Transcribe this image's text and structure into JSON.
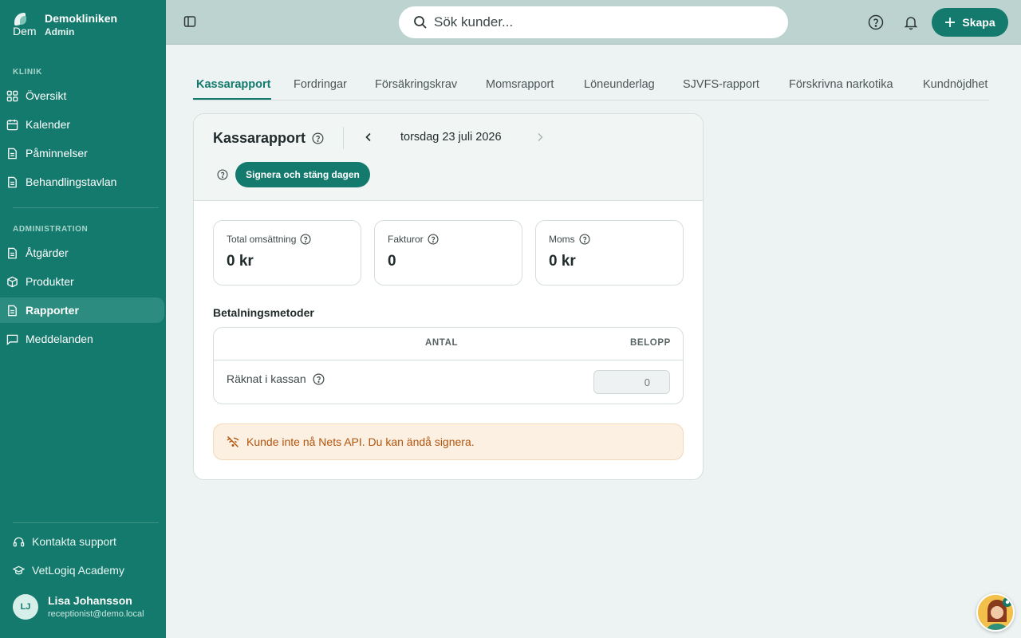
{
  "brand": {
    "name": "Demokliniken",
    "role": "Admin",
    "logo_text": "Dem"
  },
  "sidebar": {
    "section_clinic": "KLINIK",
    "section_admin": "ADMINISTRATION",
    "items": [
      {
        "label": "Översikt",
        "icon": "grid-icon"
      },
      {
        "label": "Kalender",
        "icon": "calendar-icon"
      },
      {
        "label": "Påminnelser",
        "icon": "document-icon"
      },
      {
        "label": "Behandlingstavlan",
        "icon": "document-icon"
      },
      {
        "label": "Åtgärder",
        "icon": "document-icon"
      },
      {
        "label": "Produkter",
        "icon": "box-icon"
      },
      {
        "label": "Rapporter",
        "icon": "document-icon",
        "active": true
      },
      {
        "label": "Meddelanden",
        "icon": "chat-icon"
      }
    ],
    "support": "Kontakta support",
    "academy": "VetLogiq Academy",
    "user": {
      "initials": "LJ",
      "name": "Lisa Johansson",
      "email": "receptionist@demo.local"
    }
  },
  "topbar": {
    "search_placeholder": "Sök kunder...",
    "create_label": "Skapa"
  },
  "tabs": [
    "Kassarapport",
    "Fordringar",
    "Försäkringskrav",
    "Momsrapport",
    "Löneunderlag",
    "SJVFS-rapport",
    "Förskrivna narkotika",
    "Kundnöjdhet"
  ],
  "report": {
    "title": "Kassarapport",
    "date": "torsdag 23 juli 2026",
    "sign_label": "Signera och stäng dagen",
    "stats": [
      {
        "label": "Total omsättning",
        "value": "0 kr"
      },
      {
        "label": "Fakturor",
        "value": "0"
      },
      {
        "label": "Moms",
        "value": "0 kr"
      }
    ],
    "payment_title": "Betalningsmetoder",
    "col_count": "ANTAL",
    "col_amount": "BELOPP",
    "row_label": "Räknat i kassan",
    "row_value": "0",
    "alert": "Kunde inte nå Nets API. Du kan ändå signera."
  },
  "colors": {
    "primary": "#137a6d",
    "topbar": "#bdd3cf",
    "background": "#ecf3f2",
    "alert_text": "#b2540d",
    "alert_bg": "#fcf0e2"
  }
}
